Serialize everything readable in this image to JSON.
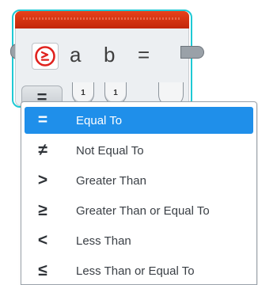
{
  "block": {
    "title_bar_color": "#d93413",
    "params": [
      "a",
      "b",
      "="
    ],
    "inputs": [
      "1",
      "1"
    ],
    "mode_symbol": "="
  },
  "menu": {
    "selected_index": 0,
    "items": [
      {
        "symbol": "=",
        "label": "Equal To"
      },
      {
        "symbol": "≠",
        "label": "Not Equal To"
      },
      {
        "symbol": ">",
        "label": "Greater Than"
      },
      {
        "symbol": "≥",
        "label": "Greater Than or Equal To"
      },
      {
        "symbol": "<",
        "label": "Less Than"
      },
      {
        "symbol": "≤",
        "label": "Less Than or Equal To"
      }
    ]
  },
  "colors": {
    "selection": "#1f8fea",
    "outline": "#1fc9d4"
  }
}
